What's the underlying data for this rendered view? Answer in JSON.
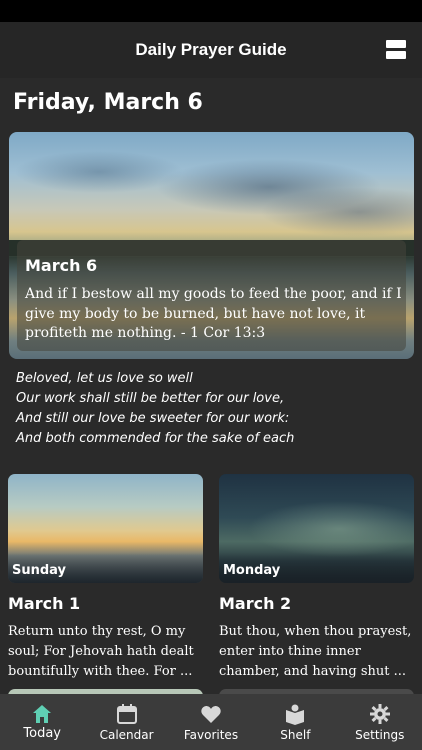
{
  "app": {
    "title": "Daily Prayer Guide"
  },
  "today": {
    "heading": "Friday, March 6",
    "hero": {
      "date": "March 6",
      "verse": "And if I bestow all my goods to feed the poor, and if I give my body to be burned, but have not love, it profiteth me nothing. - 1 Cor 13:3"
    },
    "poem": [
      "Beloved, let us love so well",
      "Our work shall still be better for our love,",
      "And still our love be sweeter for our work:",
      "And both commended for the sake of each"
    ]
  },
  "cards": [
    {
      "day": "Sunday",
      "date": "March 1",
      "text": "Return unto thy rest, O my soul; For Jehovah hath dealt bountifully with thee. For ..."
    },
    {
      "day": "Monday",
      "date": "March 2",
      "text": "But thou, when thou prayest, enter into thine inner chamber, and having shut ..."
    }
  ],
  "tabs": [
    {
      "label": "Today",
      "icon": "home-icon",
      "active": true
    },
    {
      "label": "Calendar",
      "icon": "calendar-icon",
      "active": false
    },
    {
      "label": "Favorites",
      "icon": "heart-icon",
      "active": false
    },
    {
      "label": "Shelf",
      "icon": "book-shelf-icon",
      "active": false
    },
    {
      "label": "Settings",
      "icon": "gear-icon",
      "active": false
    }
  ],
  "colors": {
    "active_tab": "#5fd0b4",
    "inactive_tab": "#d8d8d8",
    "background": "#2a2a2a",
    "nav_bar": "#262626",
    "tab_bar": "#3b3b3b"
  }
}
